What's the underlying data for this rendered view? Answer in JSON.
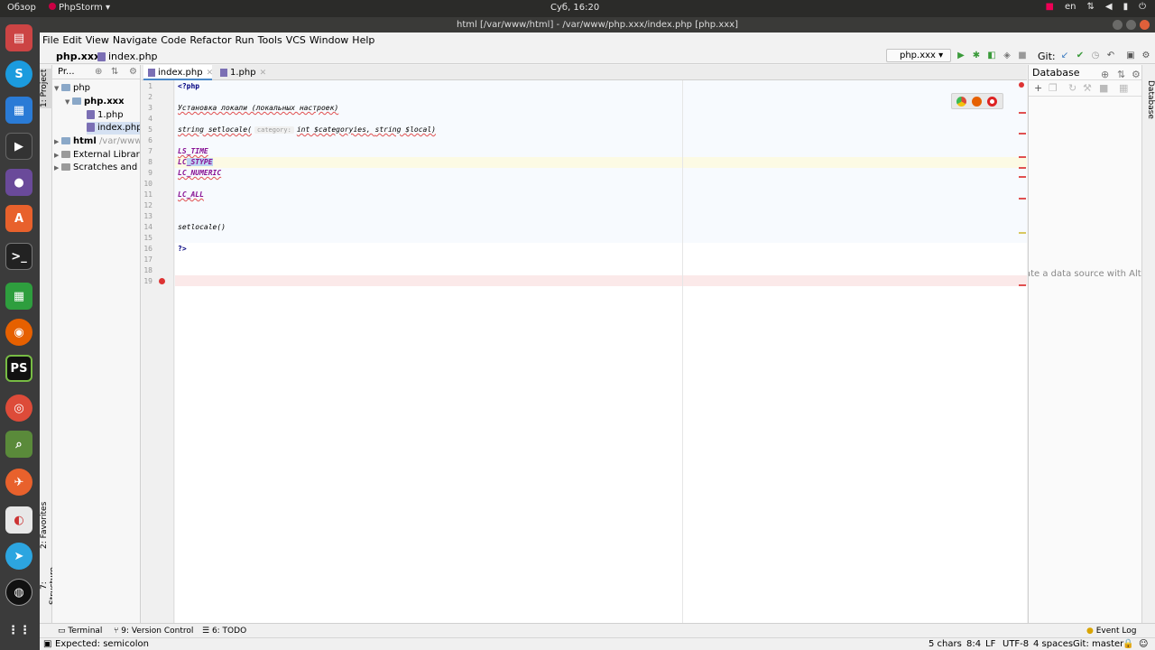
{
  "system": {
    "overview": "Обзор",
    "app_name": "PhpStorm",
    "clock": "Суб, 16:20",
    "lang": "en"
  },
  "window": {
    "title": "html [/var/www/html] - /var/www/php.xxx/index.php [php.xxx]"
  },
  "menu": [
    "File",
    "Edit",
    "View",
    "Navigate",
    "Code",
    "Refactor",
    "Run",
    "Tools",
    "VCS",
    "Window",
    "Help"
  ],
  "navbar": {
    "crumb_project": "php.xxx",
    "crumb_file": "index.php",
    "run_config": "php.xxx",
    "git_label": "Git:"
  },
  "left_tabs": {
    "project": "1: Project",
    "favorites": "2: Favorites",
    "structure": "7: Structure"
  },
  "project_panel": {
    "header": "Pr...",
    "tree": [
      {
        "label": "php",
        "indent": 0
      },
      {
        "label": "php.xxx",
        "indent": 1
      },
      {
        "label": "1.php",
        "indent": 2
      },
      {
        "label": "index.php",
        "indent": 2
      },
      {
        "label": "html",
        "suffix": "/var/www",
        "indent": 0
      },
      {
        "label": "External Librari",
        "indent": 0
      },
      {
        "label": "Scratches and C",
        "indent": 0
      }
    ]
  },
  "editor": {
    "tabs": [
      {
        "label": "index.php",
        "active": true
      },
      {
        "label": "1.php",
        "active": false
      }
    ],
    "line_numbers": [
      "1",
      "2",
      "3",
      "4",
      "5",
      "6",
      "7",
      "8",
      "9",
      "10",
      "11",
      "12",
      "13",
      "14",
      "15",
      "16",
      "17",
      "18",
      "19"
    ],
    "lines": {
      "l1": "<?php",
      "l3": "Установка локали (локальных настроек)",
      "l5_a": "string setlocale(",
      "l5_hint": "category:",
      "l5_b": "int $categoryies, ",
      "l5_c": "string $local)",
      "l7": "LS_TIME",
      "l8_a": "LC",
      "l8_b": "_STYPE",
      "l9": "LC_NUMERIC",
      "l11": "LC_ALL",
      "l14": "setlocale()",
      "l16": "?>"
    }
  },
  "database_panel": {
    "title": "Database",
    "right_tab": "Database",
    "empty_text": "ate a data source with Alt+In"
  },
  "bottom_tools": {
    "terminal": "Terminal",
    "vcs": "9: Version Control",
    "todo": "6: TODO",
    "event_log": "Event Log"
  },
  "status": {
    "message": "Expected: semicolon",
    "chars": "5 chars",
    "position": "8:4",
    "line_sep": "LF",
    "encoding": "UTF-8",
    "indent": "4 spaces",
    "git": "Git: master"
  },
  "colors": {
    "accent": "#4a88c7",
    "error": "#e05050",
    "keyword": "#000080",
    "constant": "#871094"
  }
}
